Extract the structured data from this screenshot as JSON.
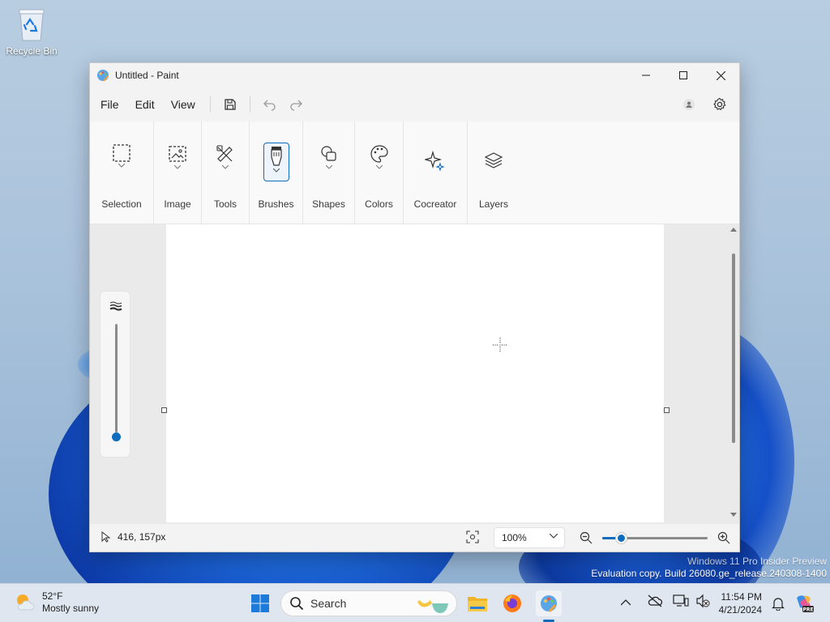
{
  "desktop": {
    "recycle_bin_label": "Recycle Bin",
    "watermark_line1": "Windows 11 Pro Insider Preview",
    "watermark_line2": "Evaluation copy. Build 26080.ge_release.240308-1400"
  },
  "window": {
    "title": "Untitled - Paint",
    "controls": [
      "minimize-icon",
      "maximize-icon",
      "close-icon"
    ]
  },
  "menubar": {
    "items": [
      "File",
      "Edit",
      "View"
    ],
    "quick_actions": [
      "save-icon",
      "undo-icon",
      "redo-icon"
    ],
    "right_icons": [
      "account-icon",
      "gear-icon"
    ]
  },
  "ribbon": {
    "groups": [
      {
        "label": "Selection",
        "icon": "selection-icon"
      },
      {
        "label": "Image",
        "icon": "image-icon"
      },
      {
        "label": "Tools",
        "icon": "tools-icon"
      },
      {
        "label": "Brushes",
        "icon": "brush-icon",
        "active": true
      },
      {
        "label": "Shapes",
        "icon": "shapes-icon"
      },
      {
        "label": "Colors",
        "icon": "palette-icon"
      },
      {
        "label": "Cocreator",
        "icon": "sparkle-icon"
      },
      {
        "label": "Layers",
        "icon": "layers-icon"
      }
    ]
  },
  "statusbar": {
    "cursor_position": "416, 157px",
    "zoom_value": "100%",
    "zoom_level_fraction": 0.12
  },
  "brush_size_level_fraction": 0.0,
  "taskbar": {
    "weather_temp": "52°F",
    "weather_desc": "Mostly sunny",
    "search_placeholder": "Search",
    "time": "11:54 PM",
    "date": "4/21/2024",
    "accent": "#0f6cbd"
  }
}
